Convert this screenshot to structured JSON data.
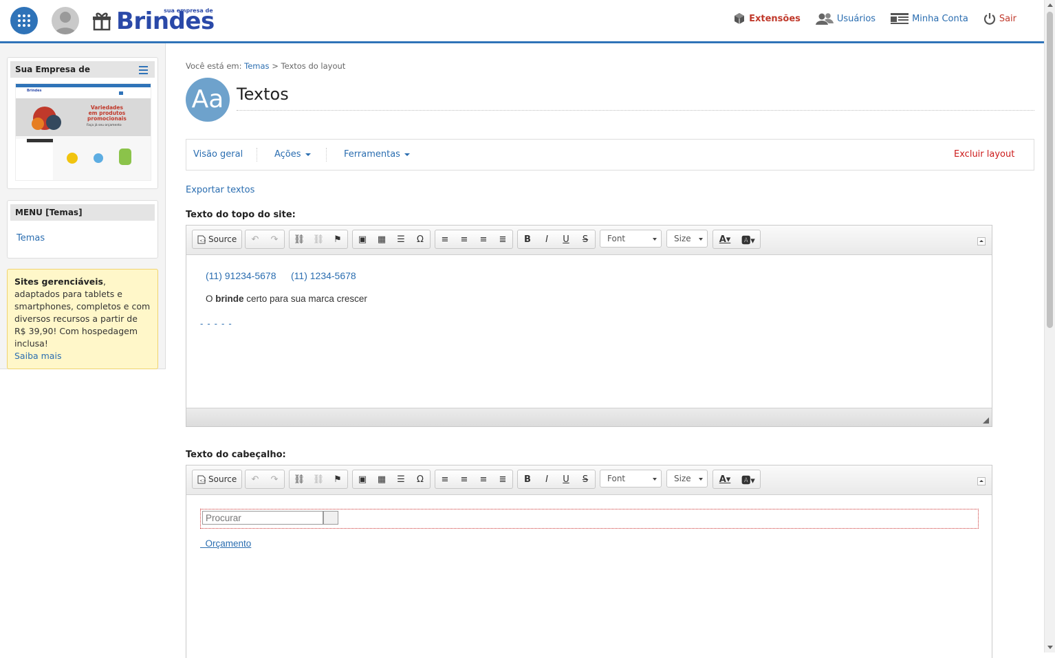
{
  "header": {
    "logo_word": "Brindes",
    "logo_tag": "sua empresa de",
    "nav": {
      "extensions": "Extensões",
      "users": "Usuários",
      "account": "Minha Conta",
      "logout": "Sair"
    }
  },
  "sidebar": {
    "site_box_title": "Sua Empresa de",
    "thumb": {
      "headline_lines": [
        "Variedades",
        "em produtos",
        "promocionais"
      ],
      "subline": "Faça já seu orçamento",
      "logo": "Brindes"
    },
    "menu_title": "MENU [Temas]",
    "menu_link": "Temas",
    "promo": {
      "bold": "Sites gerenciáveis",
      "text": ", adaptados para tablets e smartphones, completos e com diversos recursos a partir de R$ 39,90! Com hospedagem inclusa!",
      "link": "Saiba mais"
    }
  },
  "breadcrumb": {
    "prefix": "Você está em:",
    "link": "Temas",
    "separator": ">",
    "current": "Textos do layout"
  },
  "page": {
    "icon_text": "Aa",
    "title": "Textos"
  },
  "actions": {
    "overview": "Visão geral",
    "actions": "Ações",
    "tools": "Ferramentas",
    "delete": "Excluir layout"
  },
  "export_link": "Exportar textos",
  "editor_toolbar": {
    "source": "Source",
    "font": "Font",
    "size": "Size"
  },
  "editor_top": {
    "label": "Texto do topo do site:",
    "phone1": "(11) 91234-5678",
    "phone2": "(11) 1234-5678",
    "slogan_pre": "O ",
    "slogan_bold": "brinde",
    "slogan_post": " certo para sua marca crescer",
    "dashes": "-----"
  },
  "editor_header": {
    "label": "Texto do cabeçalho:",
    "search_placeholder": "Procurar",
    "quote_link": "Orçamento"
  },
  "colors": {
    "primary": "#2f73b8",
    "danger": "#cc1a1a",
    "logo": "#2a49a8",
    "promo_bg": "#fff7c9"
  }
}
